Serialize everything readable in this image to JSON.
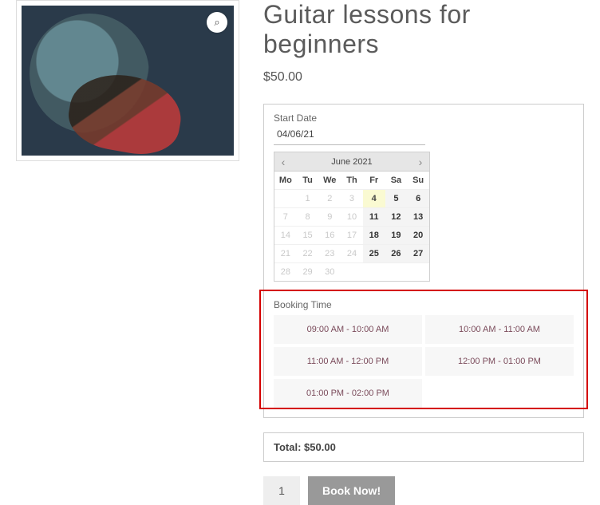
{
  "product": {
    "title": "Guitar lessons for beginners",
    "price": "$50.00"
  },
  "booking": {
    "start_date_label": "Start Date",
    "start_date_value": "04/06/21",
    "calendar": {
      "title": "June 2021",
      "dow": [
        "Mo",
        "Tu",
        "We",
        "Th",
        "Fr",
        "Sa",
        "Su"
      ],
      "weeks": [
        [
          {
            "t": "",
            "s": "blank"
          },
          {
            "t": "1",
            "s": "disabled"
          },
          {
            "t": "2",
            "s": "disabled"
          },
          {
            "t": "3",
            "s": "disabled"
          },
          {
            "t": "4",
            "s": "selected"
          },
          {
            "t": "5",
            "s": "avail"
          },
          {
            "t": "6",
            "s": "avail"
          }
        ],
        [
          {
            "t": "7",
            "s": "disabled"
          },
          {
            "t": "8",
            "s": "disabled"
          },
          {
            "t": "9",
            "s": "disabled"
          },
          {
            "t": "10",
            "s": "disabled"
          },
          {
            "t": "11",
            "s": "avail"
          },
          {
            "t": "12",
            "s": "avail"
          },
          {
            "t": "13",
            "s": "avail"
          }
        ],
        [
          {
            "t": "14",
            "s": "disabled"
          },
          {
            "t": "15",
            "s": "disabled"
          },
          {
            "t": "16",
            "s": "disabled"
          },
          {
            "t": "17",
            "s": "disabled"
          },
          {
            "t": "18",
            "s": "avail"
          },
          {
            "t": "19",
            "s": "avail"
          },
          {
            "t": "20",
            "s": "avail"
          }
        ],
        [
          {
            "t": "21",
            "s": "disabled"
          },
          {
            "t": "22",
            "s": "disabled"
          },
          {
            "t": "23",
            "s": "disabled"
          },
          {
            "t": "24",
            "s": "disabled"
          },
          {
            "t": "25",
            "s": "avail"
          },
          {
            "t": "26",
            "s": "avail"
          },
          {
            "t": "27",
            "s": "avail"
          }
        ],
        [
          {
            "t": "28",
            "s": "disabled"
          },
          {
            "t": "29",
            "s": "disabled"
          },
          {
            "t": "30",
            "s": "disabled"
          },
          {
            "t": "",
            "s": "blank"
          },
          {
            "t": "",
            "s": "blank"
          },
          {
            "t": "",
            "s": "blank"
          },
          {
            "t": "",
            "s": "blank"
          }
        ]
      ]
    },
    "time_label": "Booking Time",
    "slots": [
      "09:00 AM - 10:00 AM",
      "10:00 AM - 11:00 AM",
      "11:00 AM - 12:00 PM",
      "12:00 PM - 01:00 PM",
      "01:00 PM - 02:00 PM"
    ]
  },
  "total": {
    "label": "Total:",
    "value": "$50.00"
  },
  "cart": {
    "qty": "1",
    "button": "Book Now!"
  },
  "icons": {
    "zoom": "⌕",
    "prev": "‹",
    "next": "›"
  }
}
